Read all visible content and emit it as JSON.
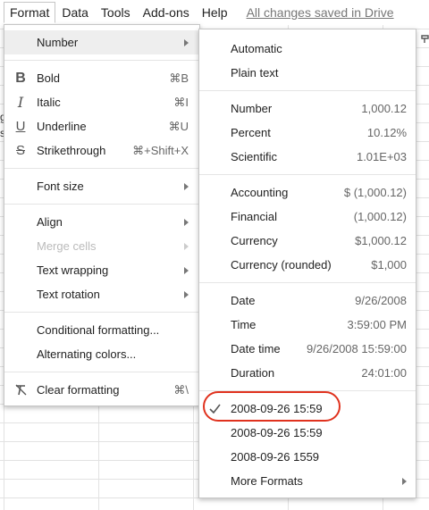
{
  "menubar": {
    "items": [
      "Format",
      "Data",
      "Tools",
      "Add-ons",
      "Help"
    ],
    "saved_status": "All changes saved in Drive"
  },
  "format_menu": {
    "number": "Number",
    "bold": {
      "label": "Bold",
      "shortcut": "⌘B",
      "icon": "bold-icon"
    },
    "italic": {
      "label": "Italic",
      "shortcut": "⌘I",
      "icon": "italic-icon"
    },
    "underline": {
      "label": "Underline",
      "shortcut": "⌘U",
      "icon": "underline-icon"
    },
    "strikethrough": {
      "label": "Strikethrough",
      "shortcut": "⌘+Shift+X",
      "icon": "strikethrough-icon"
    },
    "font_size": "Font size",
    "align": "Align",
    "merge_cells": "Merge cells",
    "text_wrapping": "Text wrapping",
    "text_rotation": "Text rotation",
    "conditional_formatting": "Conditional formatting...",
    "alternating_colors": "Alternating colors...",
    "clear_formatting": {
      "label": "Clear formatting",
      "shortcut": "⌘\\",
      "icon": "clear-formatting-icon"
    }
  },
  "number_menu": {
    "automatic": "Automatic",
    "plain_text": "Plain text",
    "number": {
      "label": "Number",
      "value": "1,000.12"
    },
    "percent": {
      "label": "Percent",
      "value": "10.12%"
    },
    "scientific": {
      "label": "Scientific",
      "value": "1.01E+03"
    },
    "accounting": {
      "label": "Accounting",
      "value": "$ (1,000.12)"
    },
    "financial": {
      "label": "Financial",
      "value": "(1,000.12)"
    },
    "currency": {
      "label": "Currency",
      "value": "$1,000.12"
    },
    "currency_rounded": {
      "label": "Currency (rounded)",
      "value": "$1,000"
    },
    "date": {
      "label": "Date",
      "value": "9/26/2008"
    },
    "time": {
      "label": "Time",
      "value": "3:59:00 PM"
    },
    "date_time": {
      "label": "Date time",
      "value": "9/26/2008 15:59:00"
    },
    "duration": {
      "label": "Duration",
      "value": "24:01:00"
    },
    "custom_1": "2008-09-26 15:59",
    "custom_2": "2008-09-26 15:59",
    "custom_3": "2008-09-26 1559",
    "more_formats": "More Formats"
  },
  "colors": {
    "highlight": "#eeeeee",
    "annotation_circle": "#e0321e"
  }
}
